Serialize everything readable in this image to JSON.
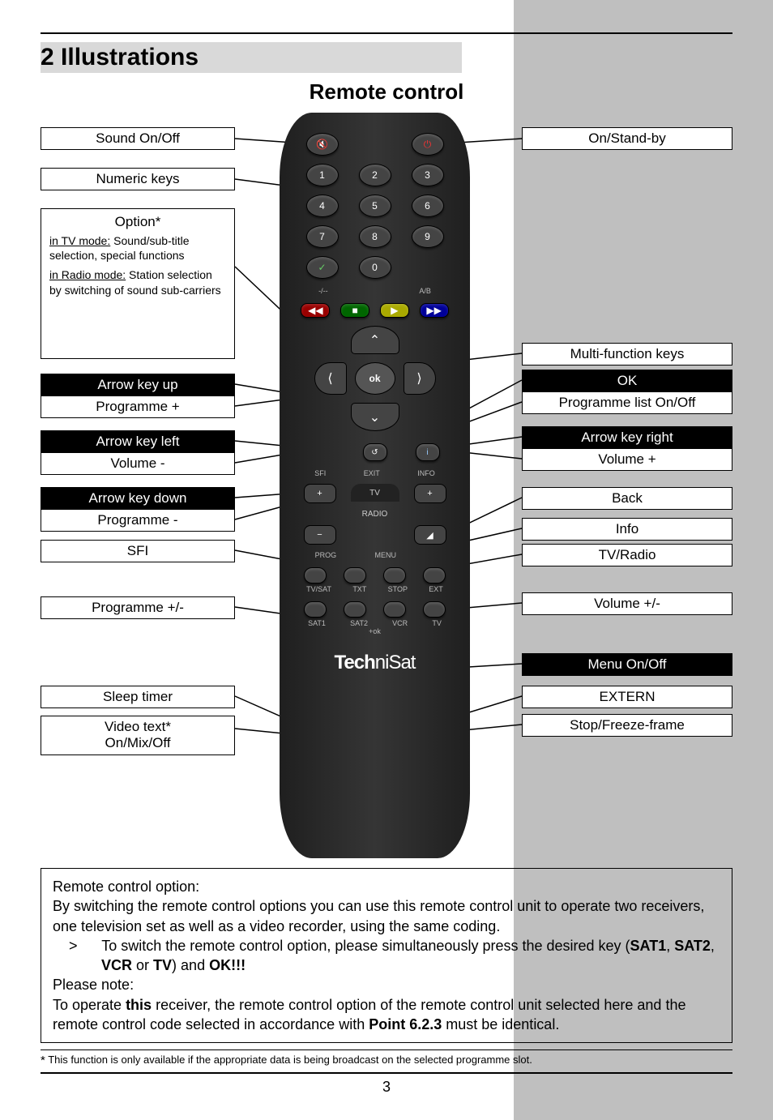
{
  "page": {
    "section_heading": "2 Illustrations",
    "subtitle": "Remote control",
    "page_number": "3"
  },
  "left_labels": {
    "sound": "Sound On/Off",
    "numeric": "Numeric keys",
    "option_title": "Option*",
    "option_tv_u": "in TV mode:",
    "option_tv_txt": " Sound/sub-title selection, special functions",
    "option_radio_u": "in Radio mode:",
    "option_radio_txt": " Station selection by switching of sound sub-carriers",
    "arrow_up": "Arrow key up",
    "prog_plus": "Programme +",
    "arrow_left": "Arrow key left",
    "vol_minus": "Volume -",
    "arrow_down": "Arrow key down",
    "prog_minus": "Programme -",
    "sfi": "SFI",
    "prog_pm": "Programme +/-",
    "sleep": "Sleep timer",
    "video_text_1": "Video text*",
    "video_text_2": "On/Mix/Off"
  },
  "right_labels": {
    "standby": "On/Stand-by",
    "multi": "Multi-function keys",
    "ok": "OK",
    "proglist": "Programme list On/Off",
    "arrow_right": "Arrow key right",
    "vol_plus": "Volume +",
    "back": "Back",
    "info": "Info",
    "tvradio": "TV/Radio",
    "volume_pm": "Volume +/-",
    "menu": "Menu On/Off",
    "extern": "EXTERN",
    "stop": "Stop/Freeze-frame"
  },
  "remote": {
    "mute_icon": "🔇",
    "power_icon": "⏻",
    "nums": [
      "1",
      "2",
      "3",
      "4",
      "5",
      "6",
      "7",
      "8",
      "9",
      "0"
    ],
    "check": "✓",
    "minus_label": "-/--",
    "ab_label": "A/B",
    "playbar": {
      "rw": "◀◀",
      "stop": "■",
      "play": "▶",
      "ff": "▶▶"
    },
    "nav": {
      "up": "⌃",
      "down": "⌄",
      "left": "⟨",
      "right": "⟩",
      "ok": "ok"
    },
    "mid": {
      "sfi": "SFI",
      "exit": "EXIT",
      "info": "INFO",
      "i": "i",
      "loop": "↺",
      "tv": "TV",
      "radio": "RADIO",
      "prog": "PROG",
      "menu": "MENU",
      "plus": "+",
      "minus": "−",
      "vol": "◢"
    },
    "bottom_labels": {
      "tvsat": "TV/SAT",
      "txt": "TXT",
      "stop": "STOP",
      "ext": "EXT"
    },
    "device_row": {
      "sat1": "SAT1",
      "sat2": "SAT2",
      "vcr": "VCR",
      "tv": "TV",
      "ok": "+ok"
    },
    "brand_left": "Tech",
    "brand_right": "niSat"
  },
  "desc": {
    "heading": "Remote control option:",
    "p1": "By switching the remote control options you can use this remote control unit to operate two receivers, one television set as well as a video recorder, using the same coding.",
    "bullet_lead": ">",
    "bullet_text": "To switch the remote control option, please simultaneously press the desired key (",
    "sat1": "SAT1",
    "comma1": ", ",
    "sat2": "SAT2",
    "comma2": ", ",
    "vcr": "VCR",
    "or": " or ",
    "tv": "TV",
    "paren": ") and ",
    "okexcl": "OK!!!",
    "note_label": "Please note:",
    "note_text_1": "To operate ",
    "note_bold": "this",
    "note_text_2": " receiver, the remote control option of the remote control unit selected here and the remote control code selected in accordance with ",
    "point": "Point 6.2.3",
    "note_text_3": " must be identical.",
    "footnote_star": "*",
    "footnote": " This function is only available if the appropriate data is being broadcast on the selected programme slot."
  }
}
